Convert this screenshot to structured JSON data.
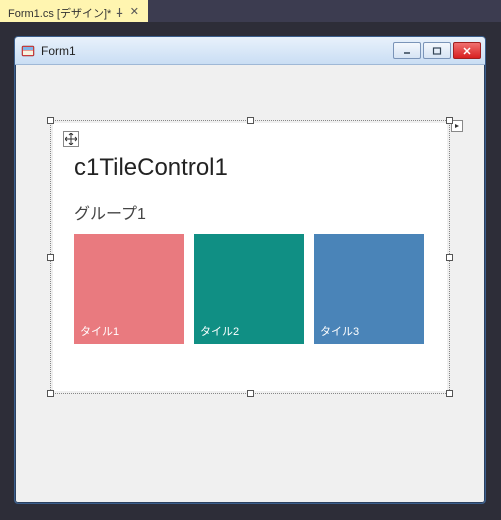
{
  "tab": {
    "label": "Form1.cs [デザイン]*"
  },
  "form": {
    "title": "Form1"
  },
  "tilecontrol": {
    "title": "c1TileControl1",
    "group_label": "グループ1",
    "tiles": [
      {
        "label": "タイル1",
        "color": "#e97a7f"
      },
      {
        "label": "タイル2",
        "color": "#108f84"
      },
      {
        "label": "タイル3",
        "color": "#4a84b8"
      }
    ]
  },
  "colors": {
    "ide_bg": "#3c3c50",
    "tab_active_bg": "#fff5b0",
    "form_bg": "#f0f0f0"
  }
}
